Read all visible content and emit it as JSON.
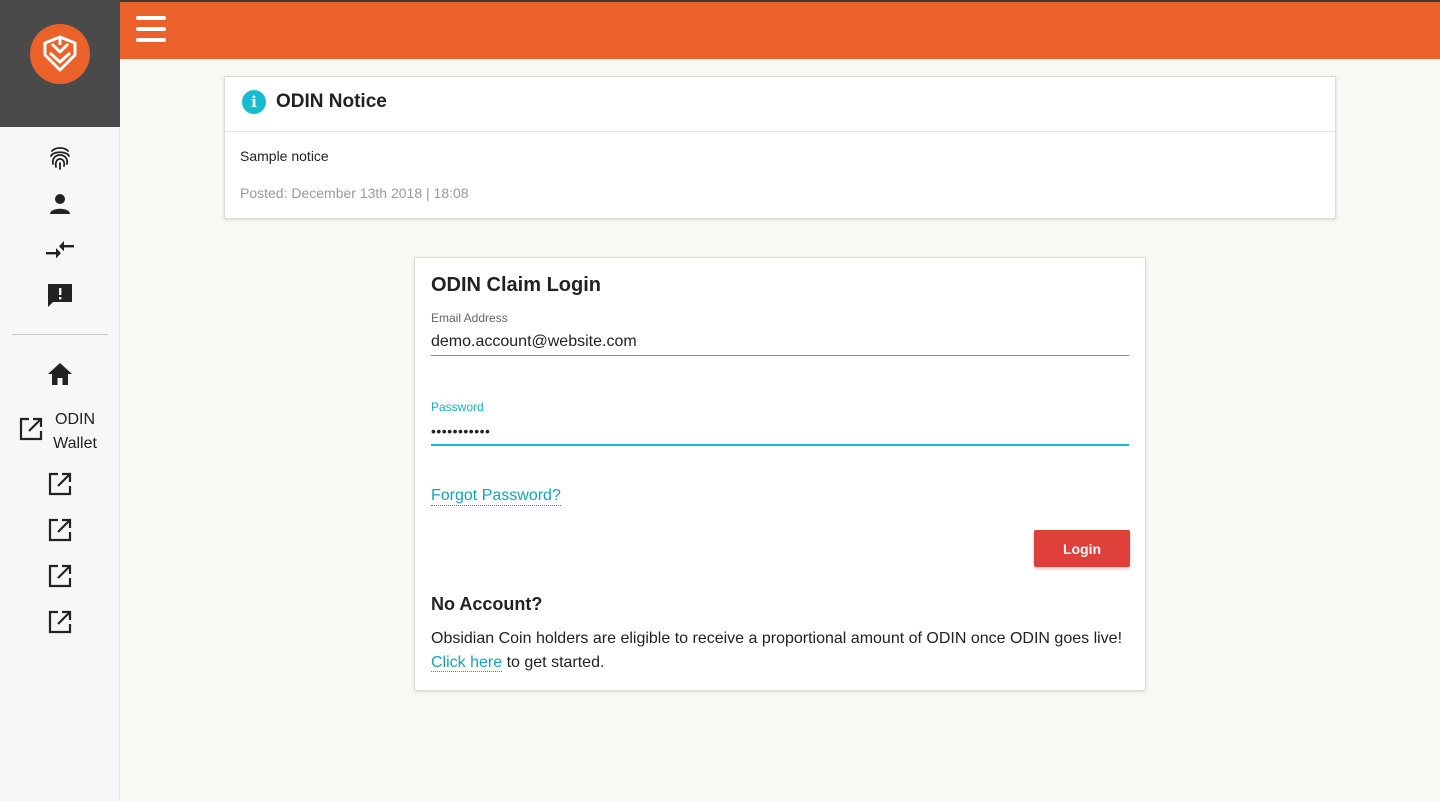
{
  "colors": {
    "brand": "#ea6229",
    "accent": "#18bcd0",
    "button": "#e0403a",
    "link": "#11a5b6"
  },
  "sidebar": {
    "logo": "odin-shield-logo",
    "icons": [
      "fingerprint-icon",
      "person-icon",
      "swap-arrows-icon",
      "feedback-icon"
    ],
    "home_icon": "home-icon",
    "wallet": {
      "icon": "external-link-icon",
      "label_line1": "ODIN",
      "label_line2": "Wallet"
    },
    "external_links": [
      "external-link-icon",
      "external-link-icon",
      "external-link-icon",
      "external-link-icon"
    ]
  },
  "header": {
    "menu_icon": "hamburger-menu-icon"
  },
  "notice": {
    "title": "ODIN Notice",
    "body": "Sample notice",
    "posted": "Posted: December 13th 2018 | 18:08"
  },
  "login": {
    "title": "ODIN Claim Login",
    "email_label": "Email Address",
    "email_value": "demo.account@website.com",
    "password_label": "Password",
    "password_value": "•••••••••••",
    "forgot": "Forgot Password?",
    "button": "Login",
    "no_account_title": "No Account?",
    "no_account_text_before": "Obsidian Coin holders are eligible to receive a proportional amount of ODIN once ODIN goes live! ",
    "click_here": "Click here",
    "no_account_text_after": " to get started."
  }
}
